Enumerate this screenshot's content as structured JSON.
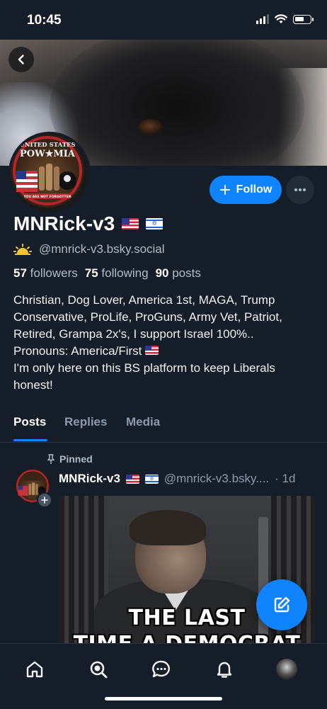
{
  "status_bar": {
    "time": "10:45"
  },
  "profile": {
    "display_name": "MNRick-v3",
    "handle": "@mnrick-v3.bsky.social",
    "stats": {
      "followers_count": "57",
      "followers_label": "followers",
      "following_count": "75",
      "following_label": "following",
      "posts_count": "90",
      "posts_label": "posts"
    },
    "bio_lines": [
      "Christian, Dog Lover, America 1st, MAGA, Trump Conservative, ProLife, ProGuns, Army Vet, Patriot, Retired, Grampa 2x's, I support Israel 100%..",
      "Pronouns: America/First",
      "I'm only here on this BS platform to keep Liberals honest!"
    ],
    "avatar_text_top": "UNITED STATES",
    "avatar_text_mid": "POW★MIA",
    "avatar_text_bottom": "YOU ARE NOT FORGOTTEN"
  },
  "actions": {
    "follow_label": "Follow"
  },
  "tabs": [
    {
      "label": "Posts",
      "active": true
    },
    {
      "label": "Replies",
      "active": false
    },
    {
      "label": "Media",
      "active": false
    }
  ],
  "post": {
    "pinned_label": "Pinned",
    "author": "MNRick-v3",
    "handle": "@mnrick-v3.bsky....",
    "time": "· 1d",
    "image_text_line1": "THE LAST",
    "image_text_line2": "TIME A DEMOCRAT"
  },
  "colors": {
    "accent": "#1083fe",
    "background": "#151d28",
    "muted_text": "#aebbc9"
  },
  "icons": {
    "back": "chevron-left-icon",
    "follow": "plus-icon",
    "more": "ellipsis-icon",
    "handle_badge": "sun-icon",
    "pin": "pin-icon",
    "compose": "pencil-icon",
    "nav": [
      "home-icon",
      "search-icon",
      "chat-icon",
      "bell-icon",
      "profile-avatar"
    ]
  }
}
